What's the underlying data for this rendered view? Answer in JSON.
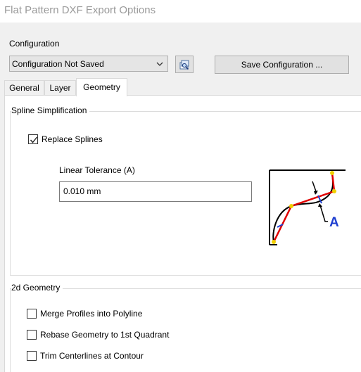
{
  "window": {
    "title": "Flat Pattern DXF Export Options"
  },
  "configuration": {
    "label": "Configuration",
    "selected": "Configuration Not Saved",
    "save_button": "Save Configuration ..."
  },
  "tabs": [
    {
      "label": "General",
      "active": false
    },
    {
      "label": "Layer",
      "active": false
    },
    {
      "label": "Geometry",
      "active": true
    }
  ],
  "spline": {
    "group_title": "Spline Simplification",
    "replace_splines": {
      "label": "Replace Splines",
      "checked": true
    },
    "linear_tolerance": {
      "label": "Linear Tolerance (A)",
      "value": "0.010 mm"
    },
    "diagram_label": "A"
  },
  "geometry_2d": {
    "group_title": "2d Geometry",
    "options": [
      {
        "label": "Merge Profiles into Polyline",
        "checked": false
      },
      {
        "label": "Rebase Geometry to 1st Quadrant",
        "checked": false
      },
      {
        "label": "Trim Centerlines at Contour",
        "checked": false
      }
    ]
  },
  "colors": {
    "accent_blue": "#1f3fd0",
    "red": "#e00000",
    "point_yellow": "#f0d000"
  },
  "icons": [
    "chevron-down-icon",
    "browse-config-icon",
    "check-icon"
  ]
}
